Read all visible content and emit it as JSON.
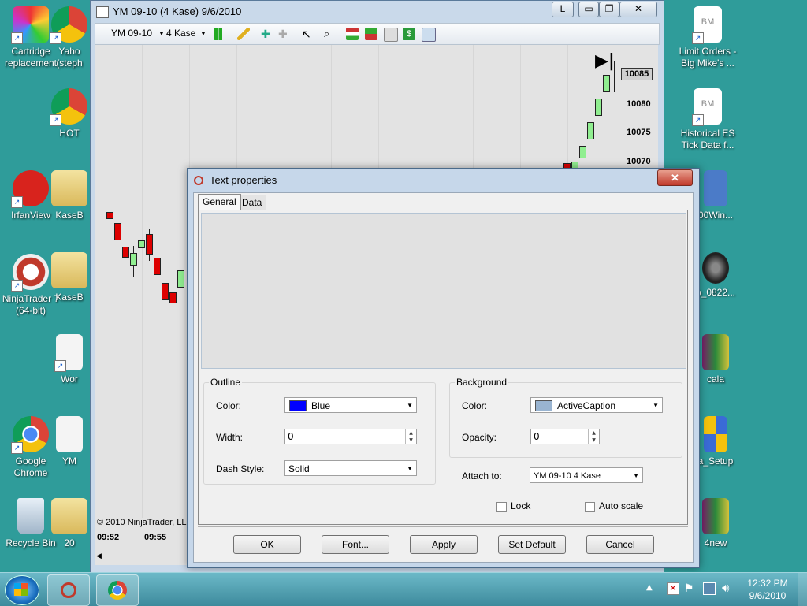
{
  "desktop": {
    "left_icons": [
      {
        "label": "Cartridge replacement"
      },
      {
        "label": "IrfanView"
      },
      {
        "label": "NinjaTrader 7 (64-bit)"
      },
      {
        "label": "Google Chrome"
      },
      {
        "label": "Recycle Bin"
      }
    ],
    "col2_icons": [
      {
        "label": "Yaho (steph"
      },
      {
        "label": "HOT"
      },
      {
        "label": "KaseB"
      },
      {
        "label": "KaseB"
      },
      {
        "label": "Wor"
      },
      {
        "label": "YM"
      },
      {
        "label": "20"
      }
    ],
    "right_icons": [
      {
        "label": "Limit Orders - Big Mike's ..."
      },
      {
        "label": "Historical ES Tick Data f..."
      },
      {
        "label": "00Win..."
      },
      {
        "label": "p_0822..."
      },
      {
        "label": "cala"
      },
      {
        "label": "a_Setup"
      },
      {
        "label": "4new"
      }
    ]
  },
  "chart_window": {
    "title": "YM 09-10 (4 Kase)  9/6/2010",
    "layout_btn": "L",
    "instrument": "YM 09-10",
    "period": "4 Kase",
    "copyright": "© 2010 NinjaTrader, LLC",
    "times": [
      "09:52",
      "09:55"
    ],
    "prices": [
      "10085",
      "10080",
      "10075",
      "10070"
    ],
    "current_price": "10085"
  },
  "dialog": {
    "title": "Text properties",
    "tabs": [
      "General",
      "Data"
    ],
    "outline": {
      "group_label": "Outline",
      "color_label": "Color:",
      "color_value": "Blue",
      "color_swatch": "#0000ff",
      "width_label": "Width:",
      "width_value": "0",
      "dash_label": "Dash Style:",
      "dash_value": "Solid"
    },
    "background": {
      "group_label": "Background",
      "color_label": "Color:",
      "color_value": "ActiveCaption",
      "color_swatch": "#99b4d1",
      "opacity_label": "Opacity:",
      "opacity_value": "0"
    },
    "attach_label": "Attach to:",
    "attach_value": "YM 09-10 4 Kase",
    "lock_label": "Lock",
    "autoscale_label": "Auto scale",
    "buttons": {
      "ok": "OK",
      "font": "Font...",
      "apply": "Apply",
      "set_default": "Set Default",
      "cancel": "Cancel"
    }
  },
  "taskbar": {
    "time": "12:32 PM",
    "date": "9/6/2010"
  },
  "colors": {
    "desktop": "#2f9c9a",
    "up_candle": "#90ee90",
    "down_candle": "#dd0000"
  }
}
